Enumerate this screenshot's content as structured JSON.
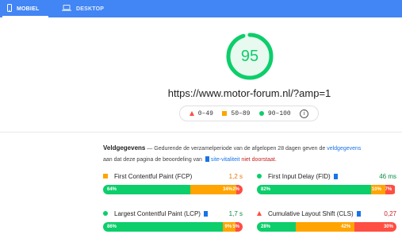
{
  "tabs": [
    {
      "label": "MOBIEL",
      "icon": "phone-icon",
      "active": true
    },
    {
      "label": "DESKTOP",
      "icon": "laptop-icon",
      "active": false
    }
  ],
  "score": {
    "value": "95",
    "fraction": 0.95,
    "color": "#0cce6b"
  },
  "url": "https://www.motor-forum.nl/?amp=1",
  "legend": [
    {
      "range": "0–49",
      "marker": "triangle",
      "color": "#ff4e42"
    },
    {
      "range": "50–89",
      "marker": "square",
      "color": "#ffa400"
    },
    {
      "range": "90–100",
      "marker": "circle",
      "color": "#0cce6b"
    }
  ],
  "legend_info": "i",
  "field_data": {
    "title": "Veldgegevens",
    "dash": " — ",
    "text1": "Gedurende de verzamelperiode van de afgelopen 28 dagen geven de ",
    "link1": "veldgegevens",
    "text2": "aan dat deze pagina de beoordeling van ",
    "link2": "site-vitaliteit",
    "fail": "niet doorstaat."
  },
  "metrics": [
    {
      "name": "First Contentful Paint (FCP)",
      "value": "1,2 s",
      "status": "average",
      "bookmark": false,
      "dist": [
        {
          "label": "64%",
          "pct": 64,
          "cls": "g"
        },
        {
          "label": "34%",
          "pct": 34,
          "cls": "o"
        },
        {
          "label": "2%",
          "pct": 2,
          "cls": "r"
        }
      ]
    },
    {
      "name": "First Input Delay (FID)",
      "value": "46 ms",
      "status": "good",
      "bookmark": true,
      "dist": [
        {
          "label": "82%",
          "pct": 82,
          "cls": "g"
        },
        {
          "label": "10%",
          "pct": 10,
          "cls": "o"
        },
        {
          "label": "7%",
          "pct": 7,
          "cls": "r"
        }
      ]
    },
    {
      "name": "Largest Contentful Paint (LCP)",
      "value": "1,7 s",
      "status": "good",
      "bookmark": true,
      "dist": [
        {
          "label": "86%",
          "pct": 86,
          "cls": "g"
        },
        {
          "label": "9%",
          "pct": 9,
          "cls": "o"
        },
        {
          "label": "5%",
          "pct": 5,
          "cls": "r"
        }
      ]
    },
    {
      "name": "Cumulative Layout Shift (CLS)",
      "value": "0,27",
      "status": "poor",
      "bookmark": true,
      "dist": [
        {
          "label": "28%",
          "pct": 28,
          "cls": "g"
        },
        {
          "label": "42%",
          "pct": 42,
          "cls": "o"
        },
        {
          "label": "30%",
          "pct": 30,
          "cls": "r"
        }
      ]
    }
  ]
}
